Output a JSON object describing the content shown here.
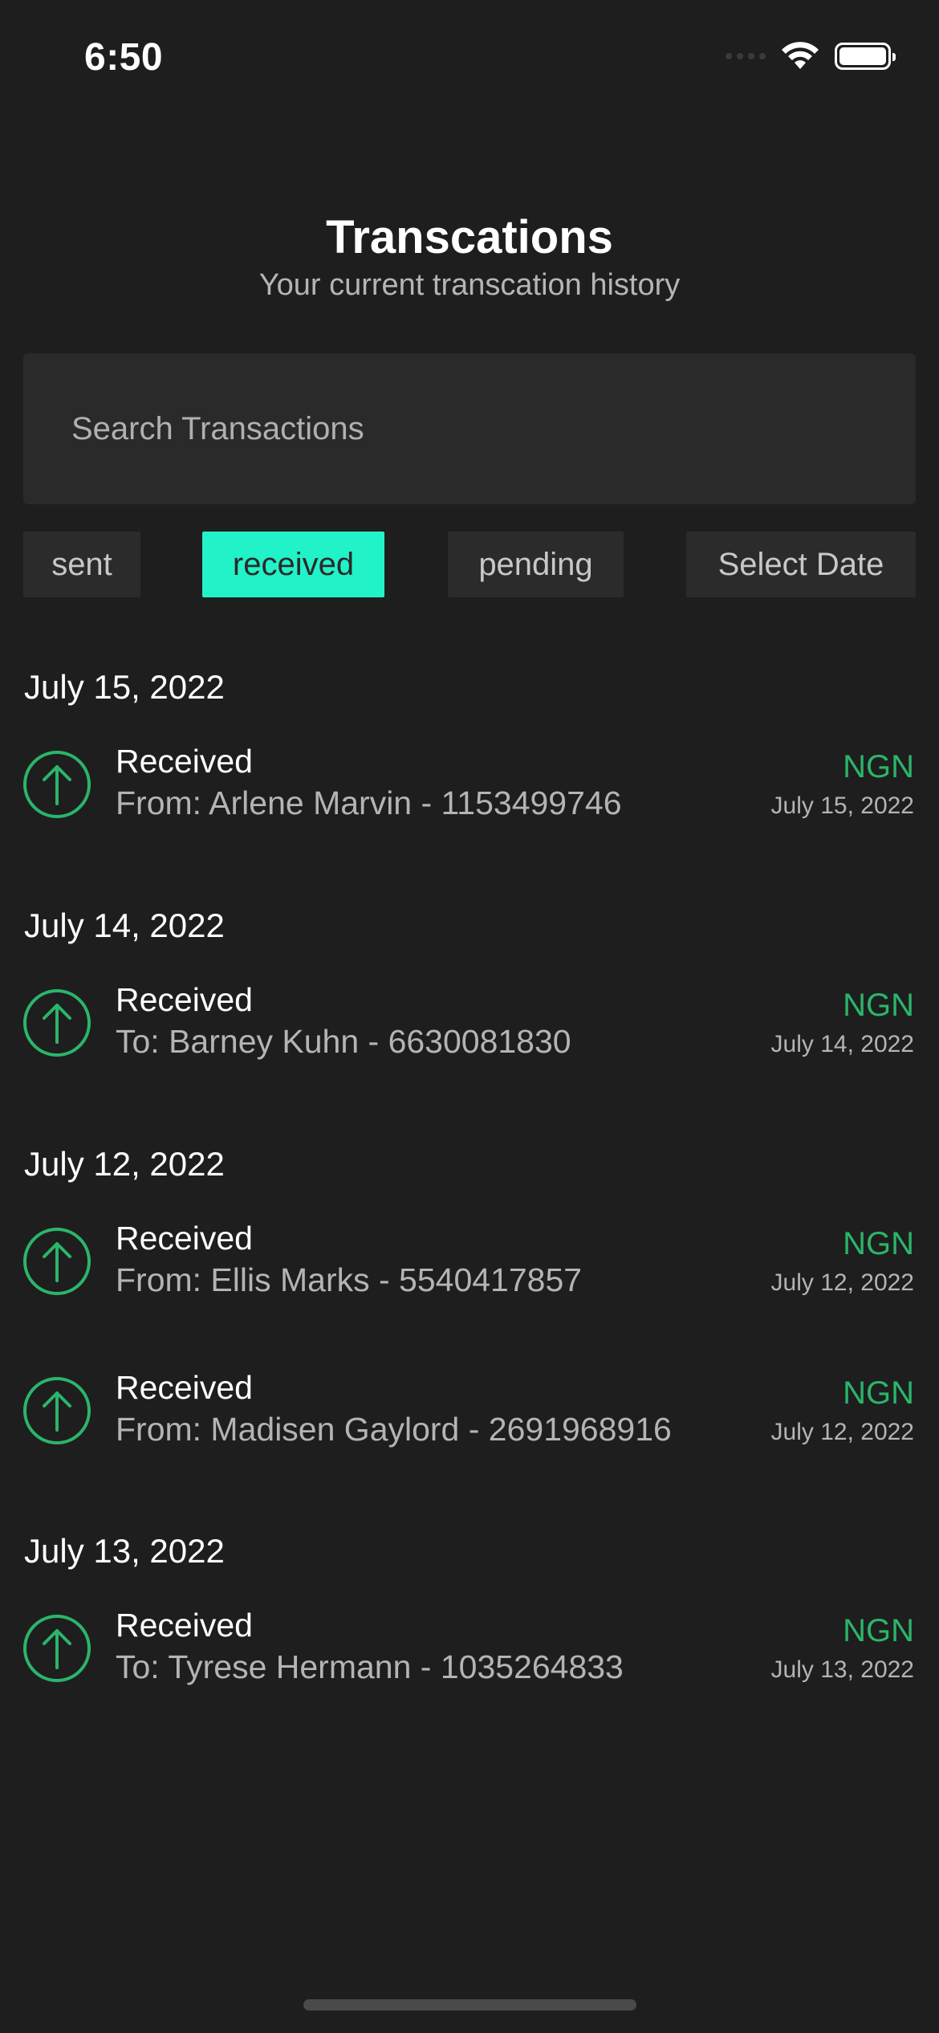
{
  "status_bar": {
    "time": "6:50"
  },
  "header": {
    "title": "Transcations",
    "subtitle": "Your current transcation history"
  },
  "search": {
    "placeholder": "Search Transactions",
    "value": ""
  },
  "filters": [
    {
      "label": "sent",
      "active": false
    },
    {
      "label": "received",
      "active": true
    },
    {
      "label": "pending",
      "active": false
    },
    {
      "label": "Select Date",
      "active": false
    }
  ],
  "colors": {
    "background": "#1e1e1e",
    "accent": "#22f2c8",
    "received_green": "#2bb56a",
    "secondary_text": "#b4b4b4"
  },
  "groups": [
    {
      "date": "July 15, 2022",
      "transactions": [
        {
          "icon": "arrow-up-circle-icon",
          "type": "Received",
          "detail": "From: Arlene Marvin - 1153499746",
          "currency": "NGN",
          "date": "July 15, 2022"
        }
      ]
    },
    {
      "date": "July 14, 2022",
      "transactions": [
        {
          "icon": "arrow-up-circle-icon",
          "type": "Received",
          "detail": "To: Barney Kuhn - 6630081830",
          "currency": "NGN",
          "date": "July 14, 2022"
        }
      ]
    },
    {
      "date": "July 12, 2022",
      "transactions": [
        {
          "icon": "arrow-up-circle-icon",
          "type": "Received",
          "detail": "From: Ellis Marks - 5540417857",
          "currency": "NGN",
          "date": "July 12, 2022"
        },
        {
          "icon": "arrow-up-circle-icon",
          "type": "Received",
          "detail": "From: Madisen Gaylord - 2691968916",
          "currency": "NGN",
          "date": "July 12, 2022"
        }
      ]
    },
    {
      "date": "July 13, 2022",
      "transactions": [
        {
          "icon": "arrow-up-circle-icon",
          "type": "Received",
          "detail": "To: Tyrese Hermann - 1035264833",
          "currency": "NGN",
          "date": "July 13, 2022"
        }
      ]
    }
  ]
}
